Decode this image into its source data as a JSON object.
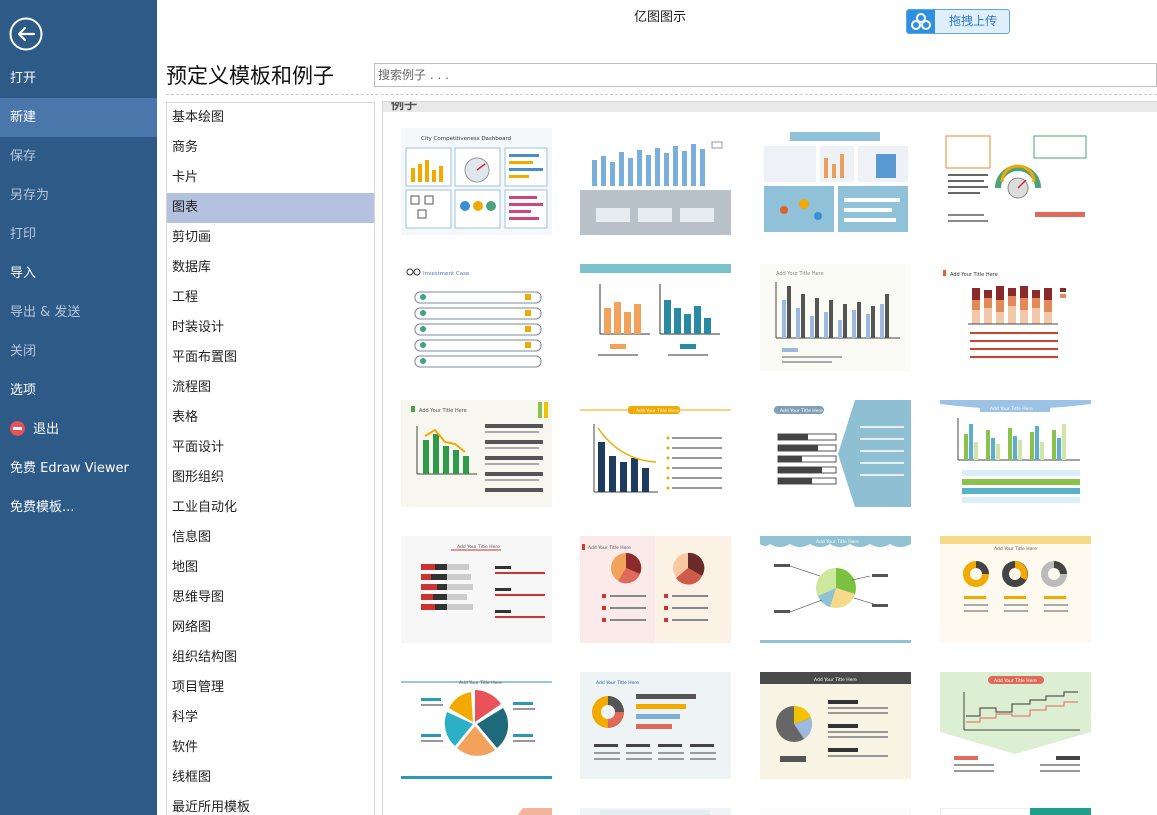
{
  "app": {
    "title": "亿图图示"
  },
  "upload_button": {
    "label": "拖拽上传"
  },
  "sidebar": {
    "items": [
      {
        "label": "打开",
        "state": "normal"
      },
      {
        "label": "新建",
        "state": "active"
      },
      {
        "label": "保存",
        "state": "disabled"
      },
      {
        "label": "另存为",
        "state": "disabled"
      },
      {
        "label": "打印",
        "state": "disabled"
      },
      {
        "label": "导入",
        "state": "normal"
      },
      {
        "label": "导出 & 发送",
        "state": "disabled"
      },
      {
        "label": "关闭",
        "state": "disabled"
      },
      {
        "label": "选项",
        "state": "normal"
      },
      {
        "label": "退出",
        "state": "normal"
      },
      {
        "label": "免费 Edraw Viewer",
        "state": "normal"
      },
      {
        "label": "免费模板...",
        "state": "normal"
      }
    ]
  },
  "main": {
    "heading": "预定义模板和例子",
    "search": {
      "placeholder": "搜索例子 . . ."
    },
    "categories": [
      "基本绘图",
      "商务",
      "卡片",
      "图表",
      "剪切画",
      "数据库",
      "工程",
      "时装设计",
      "平面布置图",
      "流程图",
      "表格",
      "平面设计",
      "图形组织",
      "工业自动化",
      "信息图",
      "地图",
      "思维导图",
      "网络图",
      "组织结构图",
      "项目管理",
      "科学",
      "软件",
      "线框图",
      "最近所用模板"
    ],
    "selected_category": "图表",
    "section_label": "例子",
    "thumbnails": [
      {
        "name": "city-competitiveness-dashboard",
        "caption": "City Competitiveness Dashboard"
      },
      {
        "name": "column-chart-blue",
        "caption": ""
      },
      {
        "name": "global-trend-dashboard",
        "caption": ""
      },
      {
        "name": "gauge-infographic",
        "caption": ""
      },
      {
        "name": "investment-case",
        "caption": "Investment Case"
      },
      {
        "name": "double-bar-chart",
        "caption": ""
      },
      {
        "name": "grouped-bar-chart-gray",
        "caption": "Add Your Title Here"
      },
      {
        "name": "stacked-bar-chart-red",
        "caption": "Add Your Title Here"
      },
      {
        "name": "green-bar-trend",
        "caption": "Add Your Title Here"
      },
      {
        "name": "navy-bar-curve",
        "caption": "Add Your Title Here"
      },
      {
        "name": "horizontal-bar-blue-panel",
        "caption": "Add Your Title Here"
      },
      {
        "name": "multi-series-bar-teal",
        "caption": "Add Your Title Here"
      },
      {
        "name": "horizontal-stacked-red",
        "caption": "Add Your Title Here"
      },
      {
        "name": "twin-pie-charts",
        "caption": "Add Your Title Here"
      },
      {
        "name": "pie-callouts-wave",
        "caption": "Add Your Title Here"
      },
      {
        "name": "three-donut-charts",
        "caption": "Add Your Title Here"
      },
      {
        "name": "exploded-pie-teal",
        "caption": "Add Your Title Here"
      },
      {
        "name": "donut-with-bars",
        "caption": "Add Your Title Here"
      },
      {
        "name": "dark-pie-panel",
        "caption": "Add Your Title Here"
      },
      {
        "name": "step-line-chart",
        "caption": "Add Your Title Here"
      },
      {
        "name": "partial-1",
        "caption": ""
      },
      {
        "name": "partial-2",
        "caption": ""
      },
      {
        "name": "partial-3",
        "caption": ""
      },
      {
        "name": "partial-4",
        "caption": ""
      }
    ]
  }
}
